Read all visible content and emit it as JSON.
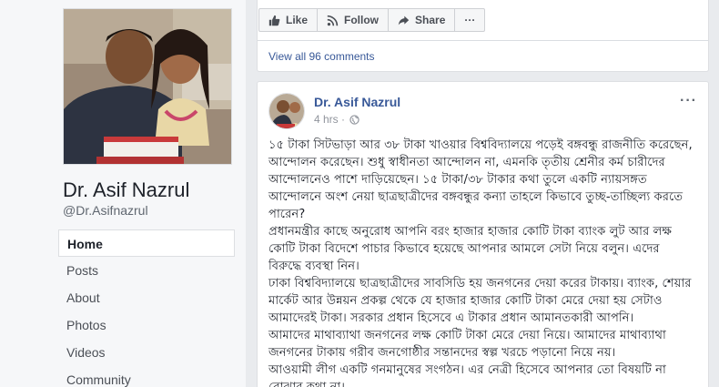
{
  "page": {
    "name": "Dr. Asif Nazrul",
    "handle": "@Dr.Asifnazrul"
  },
  "nav": {
    "items": [
      {
        "label": "Home",
        "active": true
      },
      {
        "label": "Posts"
      },
      {
        "label": "About"
      },
      {
        "label": "Photos"
      },
      {
        "label": "Videos"
      },
      {
        "label": "Community"
      }
    ]
  },
  "actions": {
    "like": "Like",
    "follow": "Follow",
    "share": "Share",
    "more": "···"
  },
  "comments": {
    "view_all": "View all 96 comments"
  },
  "post": {
    "author": "Dr. Asif Nazrul",
    "time": "4 hrs ·",
    "menu": "···",
    "paragraphs": [
      "১৫ টাকা সিটভাড়া আর ৩৮ টাকা খাওয়ার বিশ্ববিদ্যালয়ে পড়েই বঙ্গবন্ধু রাজনীতি করেছেন, আন্দোলন করেছেন। শুধু স্বাধীনতা আন্দোলন না, এমনকি তৃতীয় শ্রেনীর কর্ম চারীদের আন্দোলনেও পাশে দাড়িয়েছেন। ১৫ টাকা/৩৮ টাকার কথা তুলে একটি ন্যায়সঙ্গত আন্দোলনে অংশ নেয়া ছাত্রছাত্রীদের বঙ্গবন্ধুর কন্যা তাহলে কিভাবে তুচ্ছ-তাচ্ছিল্য করতে পারেন?",
      "প্রধানমন্ত্রীর কাছে অনুরোধ আপনি বরং হাজার হাজার কোটি টাকা ব্যাংক লুট আর লক্ষ কোটি টাকা বিদেশে পাচার কিভাবে হয়েছে আপনার আমলে সেটা নিয়ে বলুন। এদের বিরুদ্ধে ব্যবস্থা নিন।",
      "ঢাকা বিশ্ববিদ্যালয়ে ছাত্রছাত্রীদের সাবসিডি হয় জনগনের দেয়া করের টাকায়। ব্যাংক, শেয়ার মার্কেট আর উন্নয়ন প্রকল্প থেকে যে হাজার হাজার কোটি টাকা মেরে দেয়া হয় সেটাও আমাদেরই টাকা। সরকার প্রধান হিসেবে এ টাকার প্রধান আমানতকারী আপনি।",
      "আমাদের মাথাব্যাথা জনগনের লক্ষ কোটি টাকা মেরে দেয়া নিয়ে। আমাদের মাথাব্যাথা জনগনের টাকায় গরীব জনগোষ্ঠীর সন্তানদের স্বল্প খরচে পড়ানো নিয়ে নয়।",
      "আওয়ামী লীগ একটি গনমানুষের সংগঠন। এর নেত্রী হিসেবে আপনার তো বিষয়টি না বোঝার কথা না।"
    ]
  },
  "colors": {
    "link": "#385898",
    "background": "#e9ebee",
    "card": "#ffffff",
    "muted": "#90949c"
  }
}
